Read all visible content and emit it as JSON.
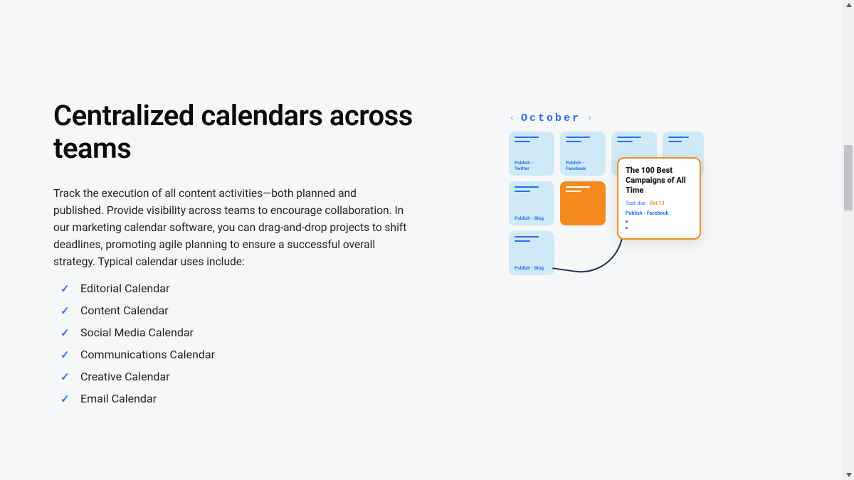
{
  "heading": "Centralized calendars across teams",
  "description": "Track the execution of all content activities—both planned and published. Provide visibility across teams to encourage collaboration. In our marketing calendar software, you can drag-and-drop projects to shift deadlines, promoting agile planning to ensure a successful overall strategy. Typical calendar uses include:",
  "bullets": [
    "Editorial Calendar",
    "Content Calendar",
    "Social Media Calendar",
    "Communications Calendar",
    "Creative Calendar",
    "Email Calendar"
  ],
  "illustration": {
    "month": "October",
    "cards": {
      "c1": "Publish - Twitter",
      "c2": "Publish - Facebook",
      "c3": "",
      "c4": "",
      "c5": "Publish - Blog",
      "c7": "Publish - Blog"
    },
    "detail": {
      "title": "The 100 Best Campaigns of All Time",
      "due_label": "Task due",
      "due_date": "Oct 13",
      "publish": "Publish - Facebook"
    }
  }
}
